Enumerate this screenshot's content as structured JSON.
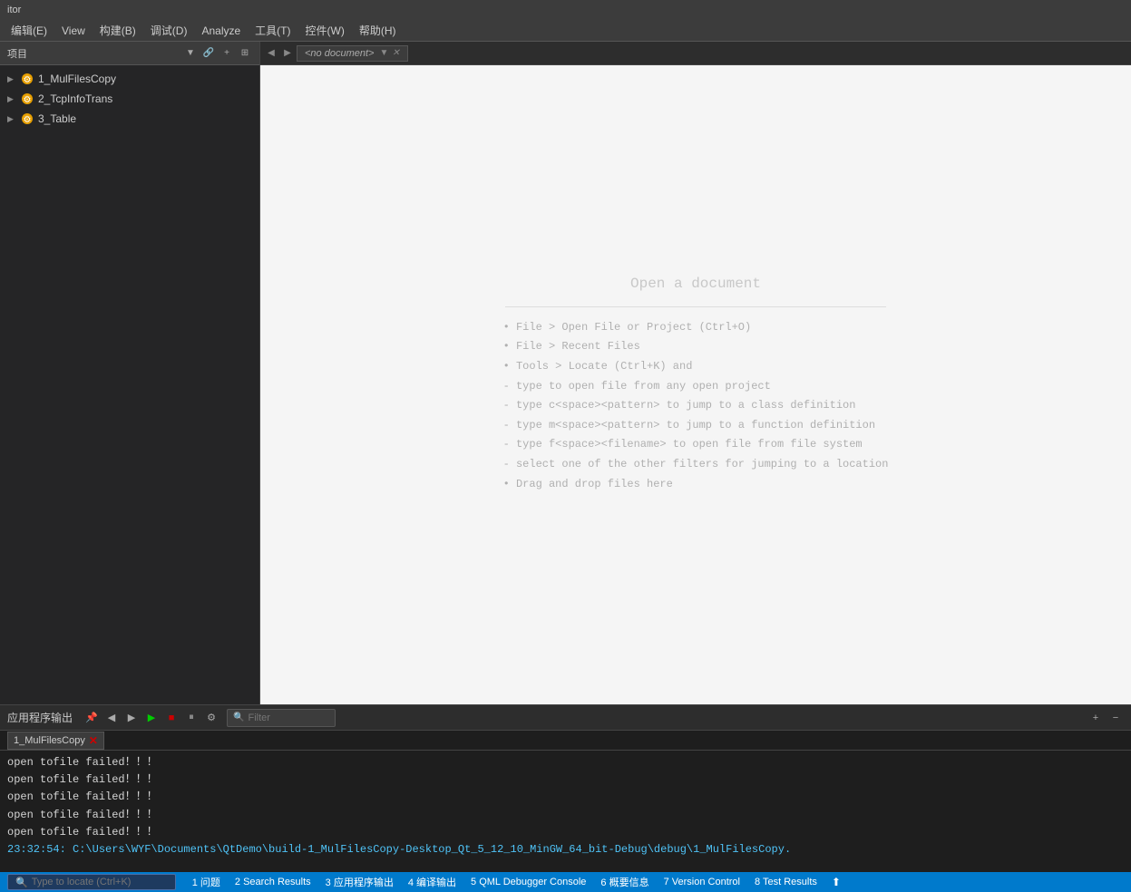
{
  "titlebar": {
    "text": "itor"
  },
  "menubar": {
    "items": [
      {
        "label": "编辑(E)"
      },
      {
        "label": "View"
      },
      {
        "label": "构建(B)"
      },
      {
        "label": "调试(D)"
      },
      {
        "label": "Analyze"
      },
      {
        "label": "工具(T)"
      },
      {
        "label": "控件(W)"
      },
      {
        "label": "帮助(H)"
      }
    ]
  },
  "sidebar": {
    "header_title": "项目",
    "items": [
      {
        "label": "1_MulFilesCopy",
        "icon": "gear"
      },
      {
        "label": "2_TcpInfoTrans",
        "icon": "gear"
      },
      {
        "label": "3_Table",
        "icon": "gear"
      }
    ]
  },
  "editor": {
    "tab_label": "<no document>",
    "open_doc": {
      "title": "Open a document",
      "hints": [
        "• File > Open File or Project (Ctrl+O)",
        "• File > Recent Files",
        "• Tools > Locate (Ctrl+K) and",
        "  - type to open file from any open project",
        "  - type c<space><pattern> to jump to a class definition",
        "  - type m<space><pattern> to jump to a function definition",
        "  - type f<space><filename> to open file from file system",
        "  - select one of the other filters for jumping to a location",
        "• Drag and drop files here"
      ]
    }
  },
  "output_panel": {
    "title": "应用程序输出",
    "filter_placeholder": "Filter",
    "active_tab": "1_MulFilesCopy",
    "lines": [
      {
        "type": "normal",
        "text": "open tofile failed！！！"
      },
      {
        "type": "normal",
        "text": "open tofile failed！！！"
      },
      {
        "type": "normal",
        "text": "open tofile failed！！！"
      },
      {
        "type": "normal",
        "text": "open tofile failed！！！"
      },
      {
        "type": "normal",
        "text": "open tofile failed！！！"
      },
      {
        "type": "path",
        "text": "23:32:54: C:\\Users\\WYF\\Documents\\QtDemo\\build-1_MulFilesCopy-Desktop_Qt_5_12_10_MinGW_64_bit-Debug\\debug\\1_MulFilesCopy."
      }
    ]
  },
  "statusbar": {
    "search_placeholder": "Type to locate (Ctrl+K)",
    "items": [
      {
        "label": "1  问题"
      },
      {
        "label": "2  Search Results"
      },
      {
        "label": "3  应用程序输出"
      },
      {
        "label": "4  编译输出"
      },
      {
        "label": "5  QML Debugger Console"
      },
      {
        "label": "6  概要信息"
      },
      {
        "label": "7  Version Control"
      },
      {
        "label": "8  Test Results"
      }
    ]
  }
}
